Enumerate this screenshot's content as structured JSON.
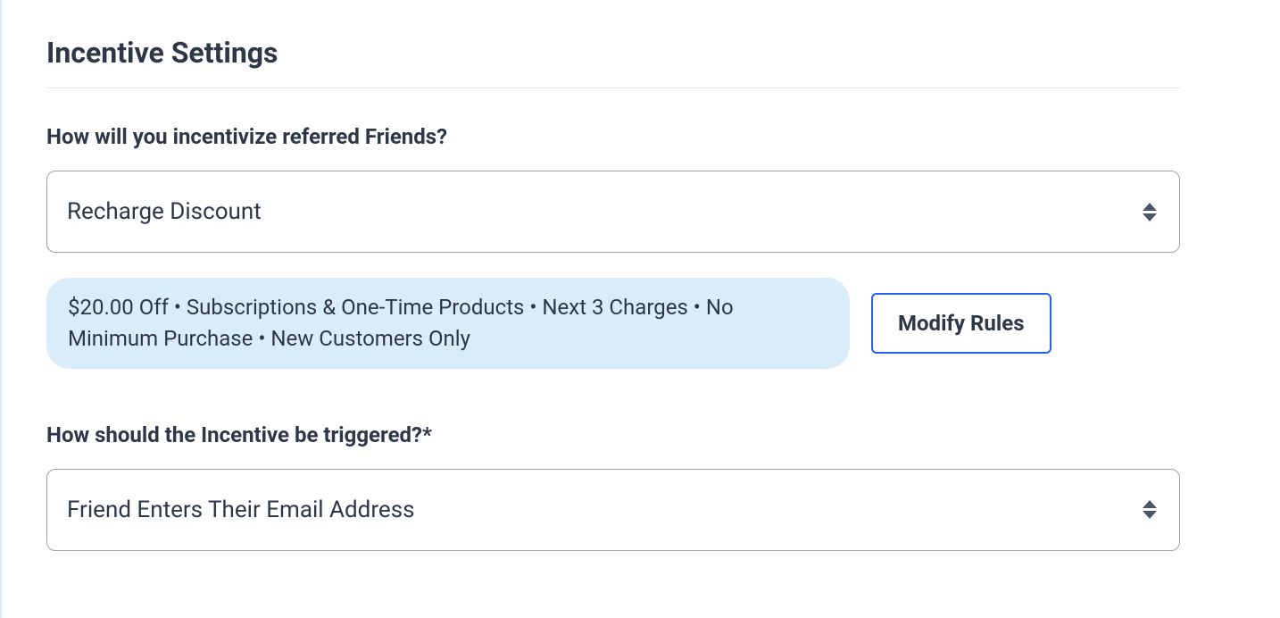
{
  "section": {
    "title": "Incentive Settings"
  },
  "incentivize": {
    "label": "How will you incentivize referred Friends?",
    "selected": "Recharge Discount"
  },
  "rules_summary": "$20.00 Off • Subscriptions & One-Time Products • Next 3 Charges • No Minimum Purchase • New Customers Only",
  "modify_button_label": "Modify Rules",
  "trigger": {
    "label": "How should the Incentive be triggered?*",
    "selected": "Friend Enters Their Email Address"
  }
}
